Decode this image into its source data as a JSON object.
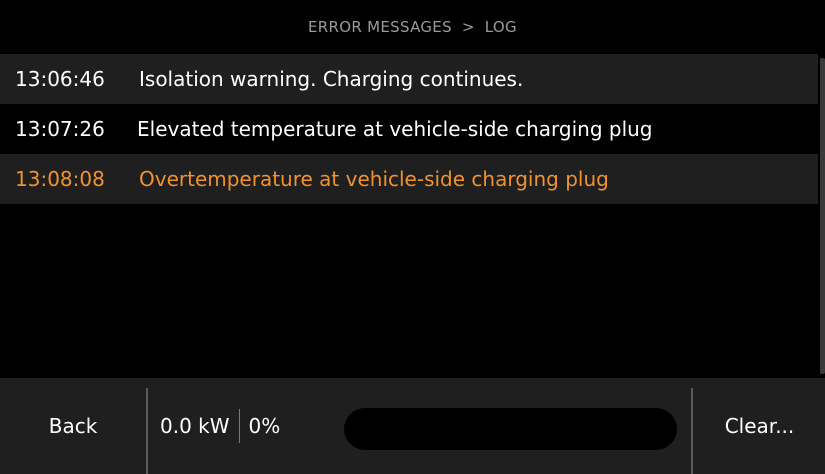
{
  "header": {
    "section": "ERROR MESSAGES",
    "separator": ">",
    "page": "LOG"
  },
  "log": [
    {
      "time": "13:06:46",
      "message": "Isolation warning. Charging continues."
    },
    {
      "time": "13:07:26",
      "message": "Elevated temperature at vehicle-side charging plug"
    },
    {
      "time": "13:08:08",
      "message": "Overtemperature at vehicle-side charging plug"
    }
  ],
  "footer": {
    "back_label": "Back",
    "power": "0.0 kW",
    "percent": "0%",
    "progress_fraction": 0,
    "clear_label": "Clear..."
  },
  "colors": {
    "accent": "#f0922e",
    "row_alt": "#1f1f1f",
    "footer_bg": "#1f1f1f",
    "header_text": "#9a9a9a"
  }
}
